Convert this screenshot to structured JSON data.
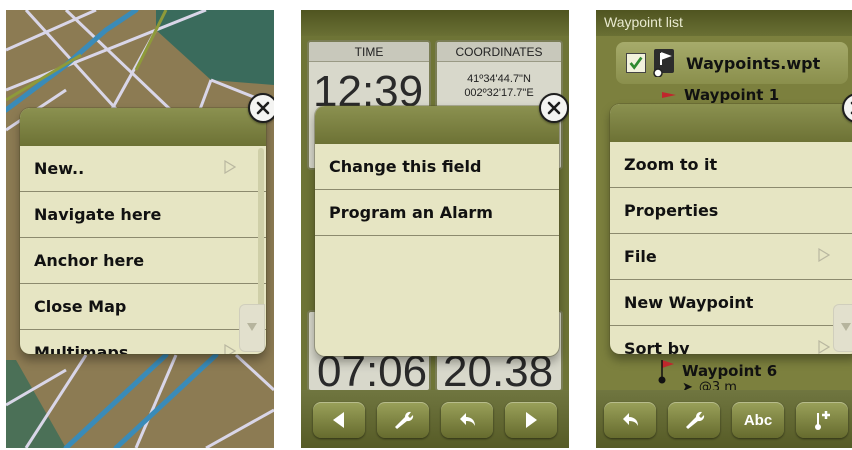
{
  "screen1": {
    "menu": {
      "items": [
        {
          "label": "New..",
          "has_submenu": true
        },
        {
          "label": "Navigate here",
          "has_submenu": false
        },
        {
          "label": "Anchor here",
          "has_submenu": false
        },
        {
          "label": "Close Map",
          "has_submenu": false
        },
        {
          "label": "Multimaps",
          "has_submenu": true
        }
      ]
    }
  },
  "screen2": {
    "fields": {
      "time": {
        "label": "TIME",
        "value": "12:39"
      },
      "coordinates": {
        "label": "COORDINATES",
        "lat": "41º34'44.7\"N",
        "lon": "002º32'17.7\"E"
      },
      "bottom_left_value": "07:06",
      "bottom_right_value": "20.38"
    },
    "menu": {
      "items": [
        {
          "label": "Change this field"
        },
        {
          "label": "Program an Alarm"
        }
      ]
    },
    "toolbar": [
      "prev-arrow-icon",
      "wrench-icon",
      "undo-icon",
      "next-arrow-icon"
    ]
  },
  "screen3": {
    "title": "Waypoint list",
    "file_name": "Waypoints.wpt",
    "waypoint_top": "Waypoint 1",
    "waypoint_bottom": {
      "name": "Waypoint 6",
      "distance": "@3 m"
    },
    "menu": {
      "items": [
        {
          "label": "Zoom to it",
          "has_submenu": false
        },
        {
          "label": "Properties",
          "has_submenu": false
        },
        {
          "label": "File",
          "has_submenu": true
        },
        {
          "label": "New Waypoint",
          "has_submenu": false
        },
        {
          "label": "Sort by",
          "has_submenu": true
        }
      ]
    },
    "toolbar": {
      "text_button": "Abc",
      "icons": [
        "undo-icon",
        "wrench-icon",
        "text-size-icon",
        "add-waypoint-icon"
      ]
    }
  },
  "colors": {
    "menu_bg": "#e6e5c3",
    "menu_header": "#7c8140",
    "app_olive": "#6e7436",
    "map_road": "#d9d6e8",
    "map_route": "#3a8bb8"
  }
}
